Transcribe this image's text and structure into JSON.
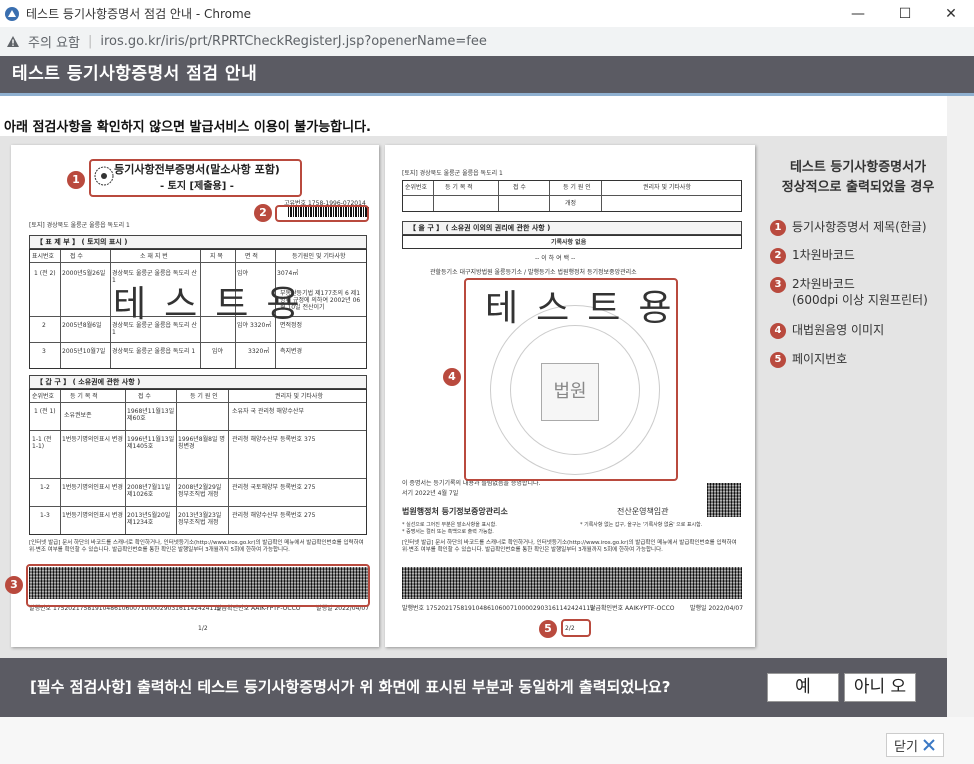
{
  "window": {
    "title": "테스트 등기사항증명서 점검 안내 - Chrome",
    "controls": {
      "minimize": "—",
      "maximize": "☐",
      "close": "✕"
    }
  },
  "address": {
    "warning_label": "주의 요함",
    "url": "iros.go.kr/iris/prt/RPRTCheckRegisterJ.jsp?openerName=fee"
  },
  "header": {
    "title": "테스트 등기사항증명서 점검 안내"
  },
  "notice": "아래 점검사항을 확인하지 않으면 발급서비스 이용이 불가능합니다.",
  "page1": {
    "doc_title_line1": "등기사항전부증명서(말소사항 포함)",
    "doc_title_line2": "- 토지 [제출용] -",
    "barcode_no": "고유번호 1758-1996-072014",
    "location": "[토지] 경상북도 울릉군 울릉읍 독도리 1",
    "section_a": "【 표 제 부 】  ( 토지의 표시 )",
    "section_a_headers": [
      "표시번호",
      "접 수",
      "소 재 지 번",
      "지 목",
      "면 적",
      "등기원인 및 기타사항"
    ],
    "section_a_rows": [
      [
        "1 (전 2)",
        "2000년5월26일",
        "경상북도 울릉군 울릉읍 독도리 산1",
        "임야",
        "3074㎡",
        "부동산등기법 제177조의 6 제1항의 규정에 의하여 2002년 06월 10일 전산이기"
      ],
      [
        "2",
        "2005년8월6일",
        "경상북도 울릉군 울릉읍 독도리 산1",
        "임야",
        "3320㎡",
        "면적정정"
      ],
      [
        "3",
        "2005년10월7일",
        "경상북도 울릉군 울릉읍 독도리 1",
        "임야",
        "3320㎡",
        "측지변경"
      ]
    ],
    "section_b": "【 갑   구 】  ( 소유권에 관한 사항 )",
    "section_b_headers": [
      "순위번호",
      "등 기 목 적",
      "접 수",
      "등 기 원 인",
      "권리자 및 기타사항"
    ],
    "section_b_rows": [
      [
        "1 (전 1)",
        "소유권보존",
        "1968년11월13일 제60호",
        "",
        "소유자 국 관리청 해양수산부"
      ],
      [
        "1-1 (전 1-1)",
        "1번등기명의인표시 변경",
        "1996년11월13일 제1405호",
        "1996년8월8일 명칭변경",
        "관리청 해양수산부 등록번호 375"
      ],
      [
        "1-2",
        "1번등기명의인표시 변경",
        "2008년7월11일 제1026호",
        "2008년2월29일 정부조직법 개정",
        "관리청 국토해양부 등록번호 275"
      ],
      [
        "1-3",
        "1번등기명의인표시 변경",
        "2013년5월20일 제1234호",
        "2013년3월23일 정부조직법 개정",
        "관리청 해양수산부 등록번호 275"
      ]
    ],
    "internet_notice": "[인터넷 발급] 문서 하단의 바코드를 스캐너로 확인하거나, 인터넷등기소(http://www.iros.go.kr)의 발급확인 메뉴에서 발급확인번호를 입력하여 위·변조 여부를 확인할 수 있습니다. 발급확인번호를 통한 확인은 발행일부터 3개월까지 5회에 한하여 가능합니다.",
    "footer_issue": "발행번호 17520217581910486106007100002903161142424119",
    "footer_confirm": "발급확인번호 AAIK-YPTF-OCCO",
    "footer_date": "발행일 2022/04/07",
    "page_num": "1/2",
    "watermark": "테스트용"
  },
  "page2": {
    "location": "[토지] 경상북도 울릉군 울릉읍 독도리 1",
    "headers": [
      "순위번호",
      "등 기 목 적",
      "접 수",
      "등 기 원 인",
      "권리자 및 기타사항"
    ],
    "reg_label": "개정",
    "section_c": "【 을   구 】  ( 소유권 이외의 권리에 관한 사항 )",
    "no_record": "기록사항 없음",
    "below": "-- 이 하 여 백 --",
    "issuer_line": "관할등기소 대구지방법원 울릉등기소 / 발행등기소 법원행정처 등기정보중앙관리소",
    "cert_line": "이 증명서는 등기기록의 내용과 틀림없음을 증명합니다.",
    "cert_date": "서기 2022년 4월 7일",
    "agency": "법원행정처 등기정보중앙관리소",
    "officer": "전산운영책임관",
    "note1": "* 실선으로 그어진 부분은 말소사항을 표시함.",
    "note2": "* 기록사항 없는 갑구, 을구는 '기록사항 없음' 으로 표시함.",
    "note3": "* 증명서는 컬러 또는 흑백으로 출력 가능함.",
    "internet_notice": "[인터넷 발급] 문서 하단의 바코드를 스캐너로 확인하거나, 인터넷등기소(http://www.iros.go.kr)의 발급확인 메뉴에서 발급확인번호를 입력하여 위·변조 여부를 확인할 수 있습니다. 발급확인번호를 통한 확인은 발행일부터 3개월까지 5회에 한하여 가능합니다.",
    "footer_issue": "발행번호 17520217581910486106007100002903161142424119",
    "footer_confirm": "발급확인번호 AAIK-YPTF-OCCO",
    "footer_date": "발행일 2022/04/07",
    "page_num": "2/2",
    "watermark": "테스트용",
    "seal_text": "법원"
  },
  "markers": [
    "1",
    "2",
    "3",
    "4",
    "5"
  ],
  "legend": {
    "title_line1": "테스트 등기사항증명서가",
    "title_line2": "정상적으로 출력되었을 경우",
    "items": [
      {
        "num": "1",
        "text": "등기사항증명서 제목(한글)"
      },
      {
        "num": "2",
        "text": "1차원바코드"
      },
      {
        "num": "3",
        "text": "2차원바코드",
        "text2": "(600dpi 이상 지원프린터)"
      },
      {
        "num": "4",
        "text": "대법원음영 이미지"
      },
      {
        "num": "5",
        "text": "페이지번호"
      }
    ]
  },
  "confirm": {
    "question": "[필수 점검사항] 출력하신 테스트 등기사항증명서가 위 화면에 표시된 부분과 동일하게 출력되었나요?",
    "yes_label": "예",
    "no_label": "아니 오"
  },
  "footer": {
    "close_label": "닫기"
  },
  "colors": {
    "accent": "#b94a3e",
    "header_bg": "#5b5b63",
    "content_bg": "#e4e4e4"
  }
}
